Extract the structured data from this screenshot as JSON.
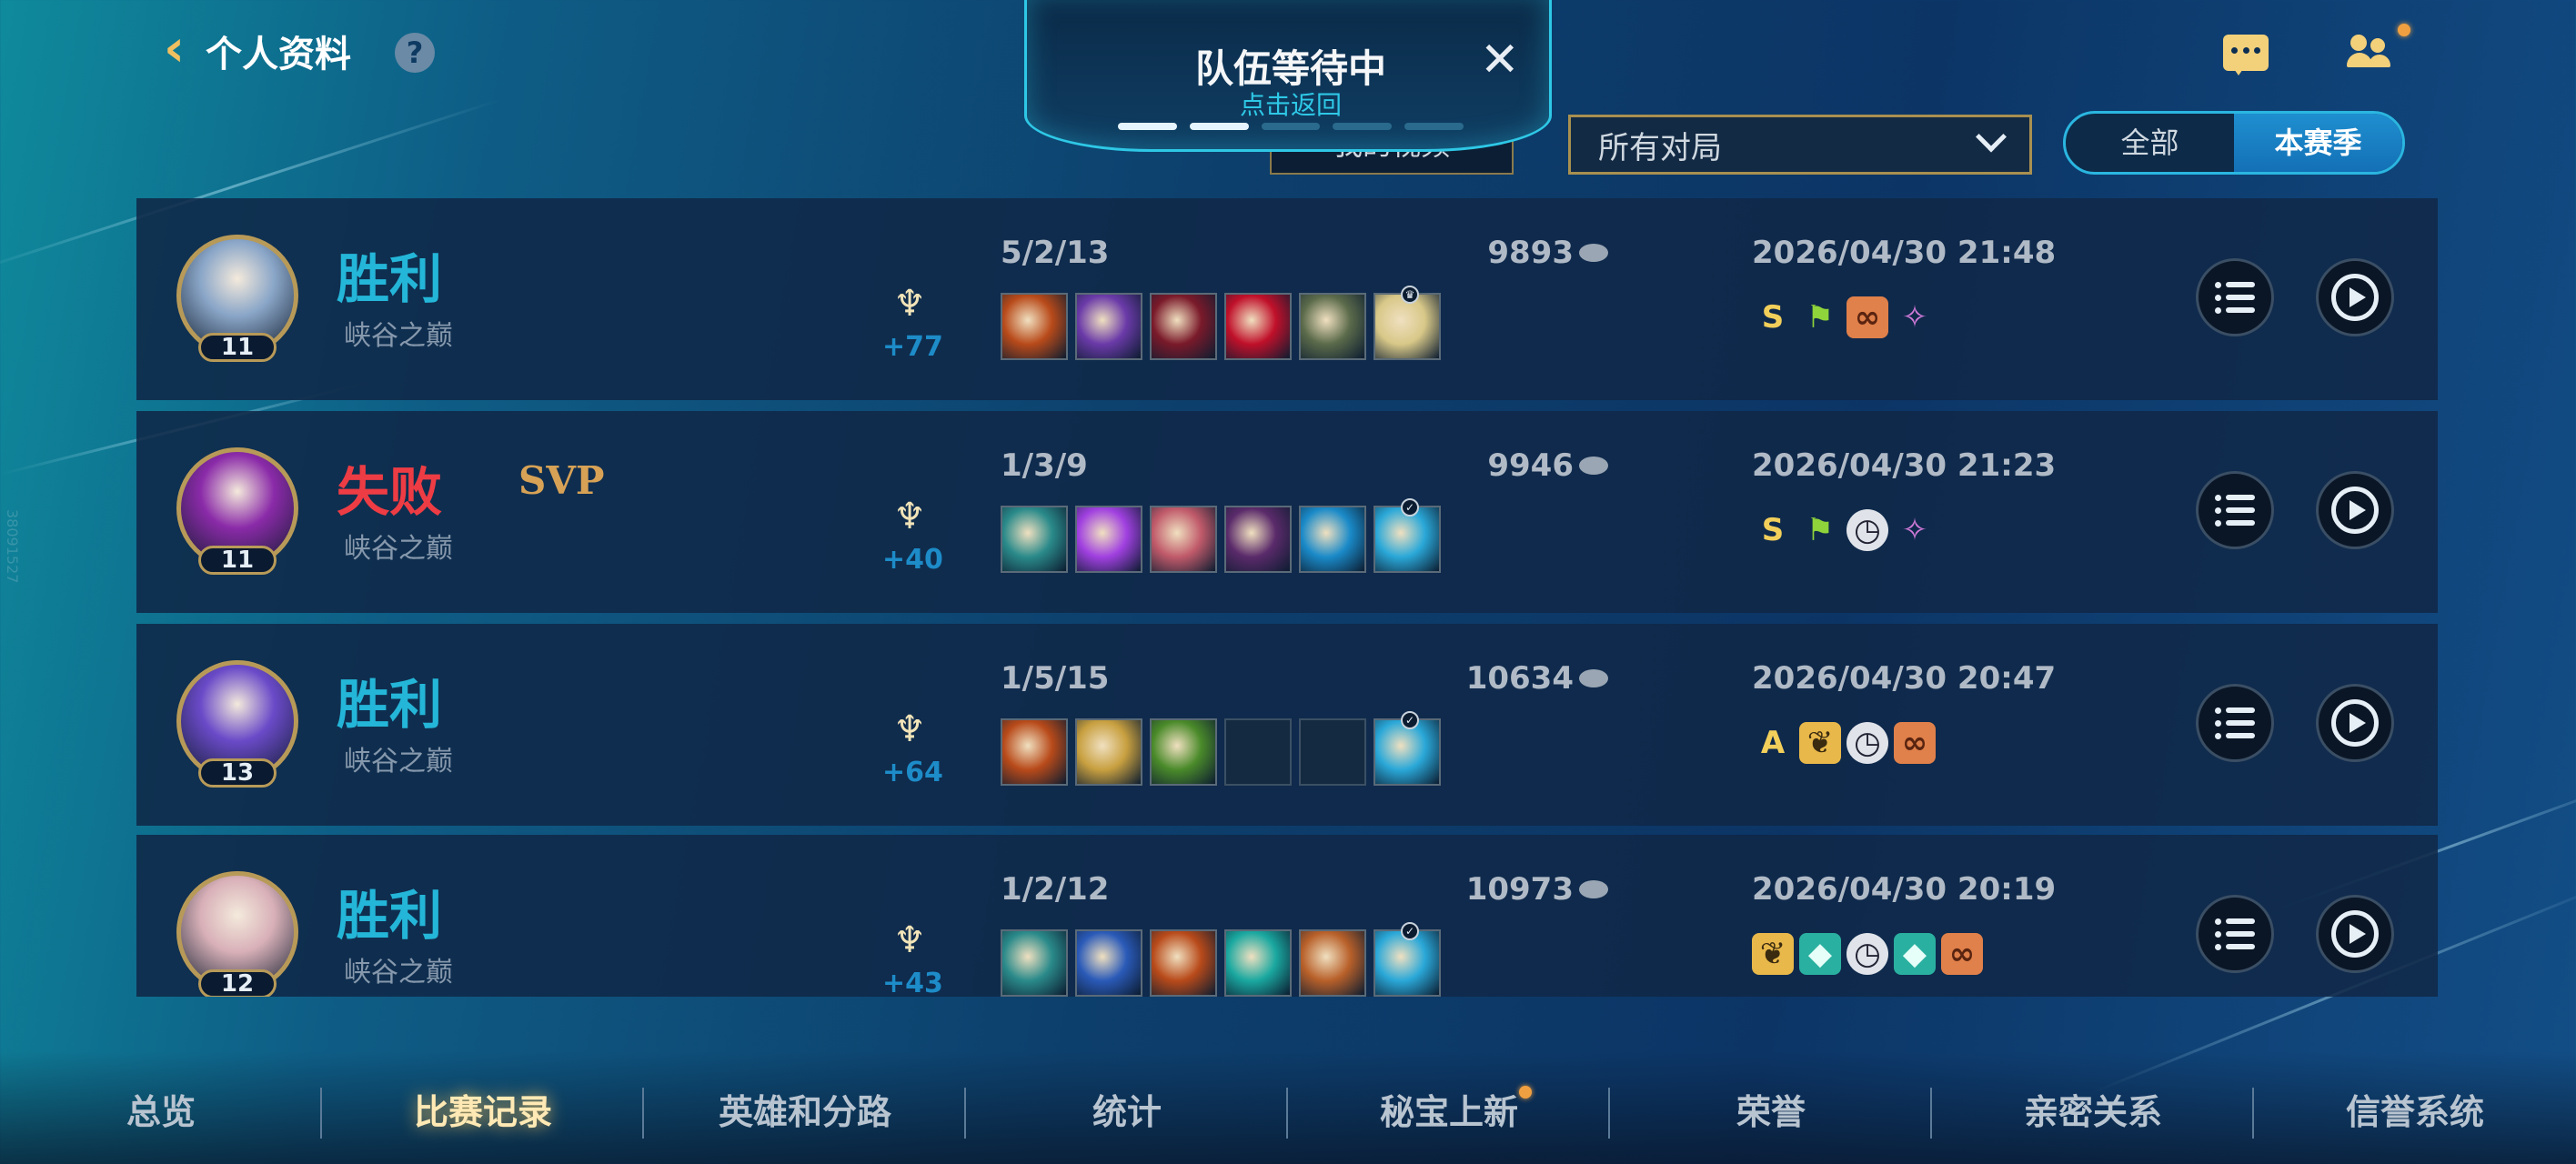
{
  "header": {
    "back_label": "个人资料",
    "help_glyph": "?",
    "queue": {
      "title": "队伍等待中",
      "subtitle": "点击返回",
      "close_glyph": "✕"
    },
    "video_button": "我的视频",
    "filter": {
      "selected": "所有对局"
    },
    "season_toggle": {
      "options": [
        "全部",
        "本赛季"
      ],
      "active": "本赛季"
    }
  },
  "side_id": "38091527",
  "matches": [
    {
      "result": "胜利",
      "mode": "峡谷之巅",
      "level": "11",
      "svp": "",
      "rank_delta": "+77",
      "kda": "5/2/13",
      "gold": "9893",
      "datetime": "2026/04/30 21:48",
      "hero_color": "#8aa6c8",
      "grade": "S",
      "items": [
        "#b84a1a",
        "#6a3aa8",
        "#7a1a2a",
        "#c0102a",
        "#5a6a4a",
        "#d8c888"
      ],
      "tags": [
        "grade-s",
        "flag-icon",
        "chain-icon",
        "wings-icon"
      ]
    },
    {
      "result": "失败",
      "mode": "峡谷之巅",
      "level": "11",
      "svp": "SVP",
      "rank_delta": "+40",
      "kda": "1/3/9",
      "gold": "9946",
      "datetime": "2026/04/30 21:23",
      "hero_color": "#8a2aa8",
      "grade": "S",
      "items": [
        "#2a8a8a",
        "#a040e0",
        "#c05a6a",
        "#5a2a6a",
        "#1a8ac8",
        "#2aa8d8"
      ],
      "tags": [
        "grade-s",
        "flag-icon",
        "clock-icon",
        "wings-icon"
      ]
    },
    {
      "result": "胜利",
      "mode": "峡谷之巅",
      "level": "13",
      "svp": "",
      "rank_delta": "+64",
      "kda": "1/5/15",
      "gold": "10634",
      "datetime": "2026/04/30 20:47",
      "hero_color": "#6a4ac8",
      "grade": "A",
      "items": [
        "#b84a1a",
        "#c8a040",
        "#4a8a2a",
        "",
        "",
        "#2aa8d8"
      ],
      "tags": [
        "grade-a",
        "leaf-icon",
        "clock-icon",
        "chain-icon"
      ]
    },
    {
      "result": "胜利",
      "mode": "峡谷之巅",
      "level": "12",
      "svp": "",
      "rank_delta": "+43",
      "kda": "1/2/12",
      "gold": "10973",
      "datetime": "2026/04/30 20:19",
      "hero_color": "#d8b0b8",
      "grade": "",
      "items": [
        "#2a8a8a",
        "#2a5ab8",
        "#b84a1a",
        "#1aa8a0",
        "#b8602a",
        "#2aa8d8"
      ],
      "tags": [
        "leaf-icon",
        "shield-icon",
        "clock-icon",
        "shield-icon",
        "chain-icon"
      ]
    }
  ],
  "bottom_nav": [
    "总览",
    "比赛记录",
    "英雄和分路",
    "统计",
    "秘宝上新",
    "荣誉",
    "亲密关系",
    "信誉系统"
  ],
  "bottom_nav_active": "比赛记录",
  "colors": {
    "win": "#24b6d8",
    "lose": "#ee3c44",
    "accent_gold": "#b89a58",
    "toggle_active": "#1e8fd0"
  }
}
